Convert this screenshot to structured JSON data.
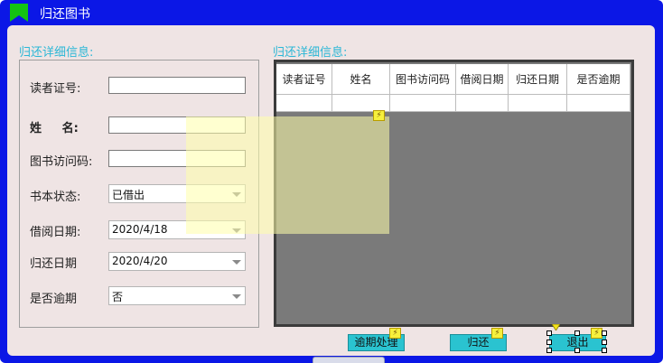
{
  "window": {
    "title": "归还图书",
    "icon": "bookmark-icon",
    "title_color": "#0b17e6",
    "client_color": "#efe4e4"
  },
  "left_section": {
    "title": "归还详细信息:",
    "fields": {
      "reader_id_label": "读者证号:",
      "name_label": "姓     名:",
      "book_code_label": "图书访问码:",
      "status_label": "书本状态:",
      "status_value": "已借出",
      "borrow_date_label": "借阅日期:",
      "borrow_date_value": "2020/4/18",
      "return_date_label": "归还日期",
      "return_date_value": "2020/4/20",
      "overdue_label": "是否逾期",
      "overdue_value": "否"
    }
  },
  "right_section": {
    "title": "归还详细信息:",
    "columns": [
      "读者证号",
      "姓名",
      "图书访问码",
      "借阅日期",
      "归还日期",
      "是否逾期"
    ]
  },
  "buttons": {
    "overdue": "逾期处理",
    "return": "归还",
    "exit": "退出"
  },
  "colors": {
    "accent": "#2ac3d0",
    "section_title": "#2bb7d6",
    "grid_background": "#7a7a7a"
  }
}
